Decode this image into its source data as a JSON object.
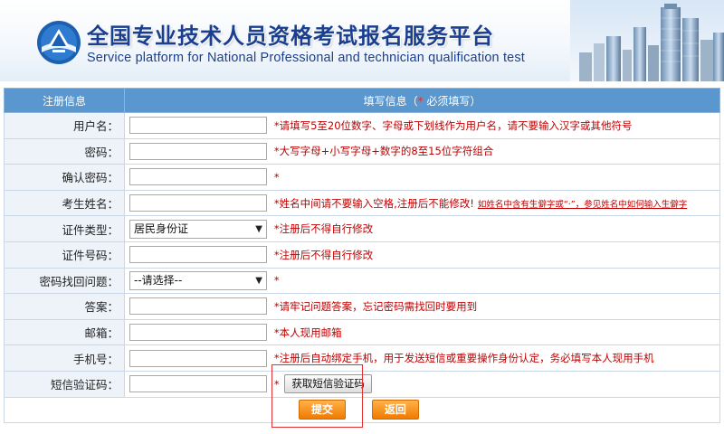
{
  "header": {
    "title_cn": "全国专业技术人员资格考试报名服务平台",
    "title_en": "Service platform for National Professional and technician  qualification test",
    "logo_icon": "emblem-icon"
  },
  "table_header": {
    "col1": "注册信息",
    "col2_prefix": "填写信息（",
    "col2_star": "*",
    "col2_suffix": " 必须填写）"
  },
  "rows": [
    {
      "label": "用户名：",
      "type": "input",
      "value": "",
      "hint": "*请填写5至20位数字、字母或下划线作为用户名，请不要输入汉字或其他符号"
    },
    {
      "label": "密码：",
      "type": "input",
      "value": "",
      "hint": "*大写字母+小写字母+数字的8至15位字符组合"
    },
    {
      "label": "确认密码：",
      "type": "input",
      "value": "",
      "hint": "*"
    },
    {
      "label": "考生姓名：",
      "type": "input",
      "value": "",
      "hint": "*姓名中间请不要输入空格,注册后不能修改!",
      "link": "如姓名中含有生僻字或“·”，参见姓名中如何输入生僻字"
    },
    {
      "label": "证件类型：",
      "type": "select",
      "value": "居民身份证",
      "hint": "*注册后不得自行修改"
    },
    {
      "label": "证件号码：",
      "type": "input",
      "value": "",
      "hint": "*注册后不得自行修改"
    },
    {
      "label": "密码找回问题：",
      "type": "select",
      "value": "--请选择--",
      "hint": "*"
    },
    {
      "label": "答案：",
      "type": "input",
      "value": "",
      "hint": "*请牢记问题答案，忘记密码需找回时要用到"
    },
    {
      "label": "邮箱：",
      "type": "input",
      "value": "",
      "hint": "*本人现用邮箱"
    },
    {
      "label": "手机号：",
      "type": "input",
      "value": "",
      "hint": "*注册后自动绑定手机，用于发送短信或重要操作身份认定，务必填写本人现用手机"
    },
    {
      "label": "短信验证码：",
      "type": "input",
      "value": "",
      "hint": "*",
      "button": "获取短信验证码"
    }
  ],
  "buttons": {
    "submit": "提交",
    "back": "返回"
  },
  "colors": {
    "header_bar": "#5a97cf",
    "label_bg": "#eef3f9",
    "hint_red": "#c00000",
    "button_orange": "#f07a00",
    "highlight_red": "#e03030"
  }
}
